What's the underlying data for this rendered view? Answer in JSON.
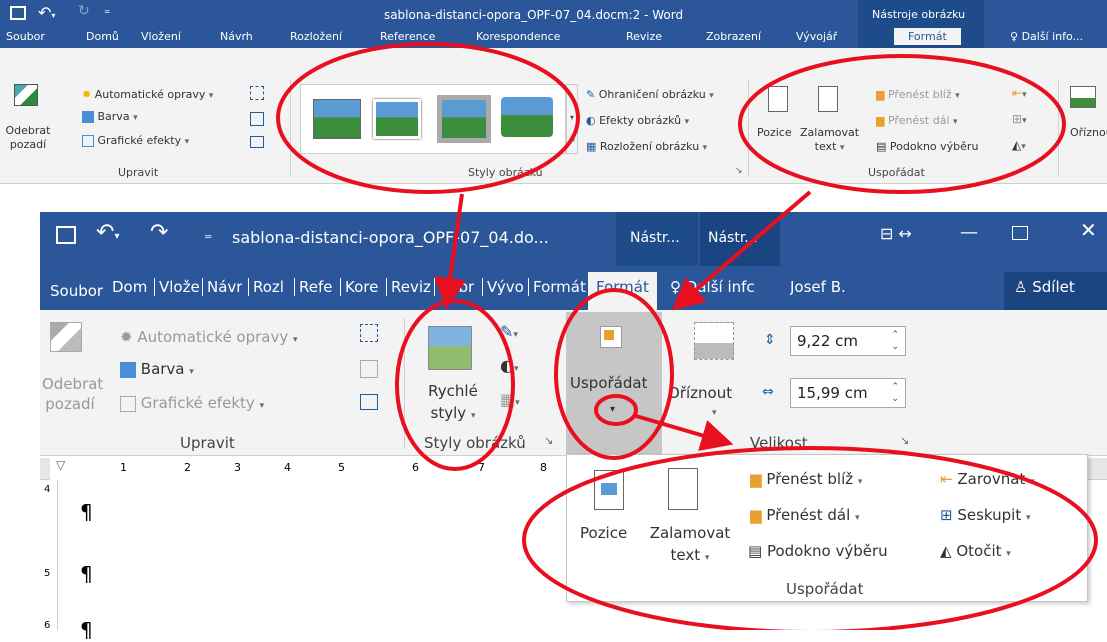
{
  "top": {
    "title": "sablona-distanci-opora_OPF-07_04.docm:2 - Word",
    "context_group": "Nástroje obrázku",
    "tabs": [
      "Soubor",
      "Domů",
      "Vložení",
      "Návrh",
      "Rozložení",
      "Reference",
      "Korespondence",
      "Revize",
      "Zobrazení",
      "Vývojář",
      "Formát"
    ],
    "tell": "Další info...",
    "adjust": {
      "remove_bg": [
        "Odebrat",
        "pozadí"
      ],
      "corrections": "Automatické opravy",
      "color": "Barva",
      "artistic": "Grafické efekty",
      "group": "Upravit"
    },
    "styles": {
      "border": "Ohraničení obrázku",
      "effects": "Efekty obrázků",
      "layout": "Rozložení obrázku",
      "group": "Styly obrázků"
    },
    "arrange": {
      "position": "Pozice",
      "wrap": [
        "Zalamovat",
        "text"
      ],
      "forward": "Přenést blíž",
      "backward": "Přenést dál",
      "pane": "Podokno výběru",
      "group": "Uspořádat"
    },
    "crop": "Oříznou"
  },
  "bottom": {
    "title": "sablona-distanci-opora_OPF-07_04.do...",
    "ctx1": "Nástr...",
    "ctx2": "Nástr...",
    "tabs": [
      "Soubor",
      "Dom",
      "Vlože",
      "Návr",
      "Rozl",
      "Refe",
      "Kore",
      "Reviz",
      "Zobr",
      "Vývo",
      "Formát",
      "Formát"
    ],
    "tell": "Další infc",
    "user": "Josef B.",
    "share": "Sdílet",
    "adjust": {
      "remove_bg": [
        "Odebrat",
        "pozadí"
      ],
      "corrections": "Automatické opravy",
      "color": "Barva",
      "artistic": "Grafické efekty",
      "group": "Upravit"
    },
    "quick_styles": [
      "Rychlé",
      "styly"
    ],
    "styles_group": "Styly obrázků",
    "arrange_btn": "Uspořádat",
    "crop": "Oříznout",
    "height": "9,22 cm",
    "width": "15,99 cm",
    "size_group": "Velikost",
    "ruler": [
      "1",
      "2",
      "3",
      "4",
      "5",
      "6",
      "7",
      "8"
    ],
    "vruler": [
      "4",
      "5",
      "6"
    ],
    "pilcrow": "¶"
  },
  "popup": {
    "position": "Pozice",
    "wrap": [
      "Zalamovat",
      "text"
    ],
    "forward": "Přenést blíž",
    "backward": "Přenést dál",
    "pane": "Podokno výběru",
    "align": "Zarovnat",
    "group_btn": "Seskupit",
    "rotate": "Otočit",
    "group": "Uspořádat"
  },
  "colors": {
    "word_blue": "#2b579a",
    "annotation_red": "#e8101e"
  }
}
